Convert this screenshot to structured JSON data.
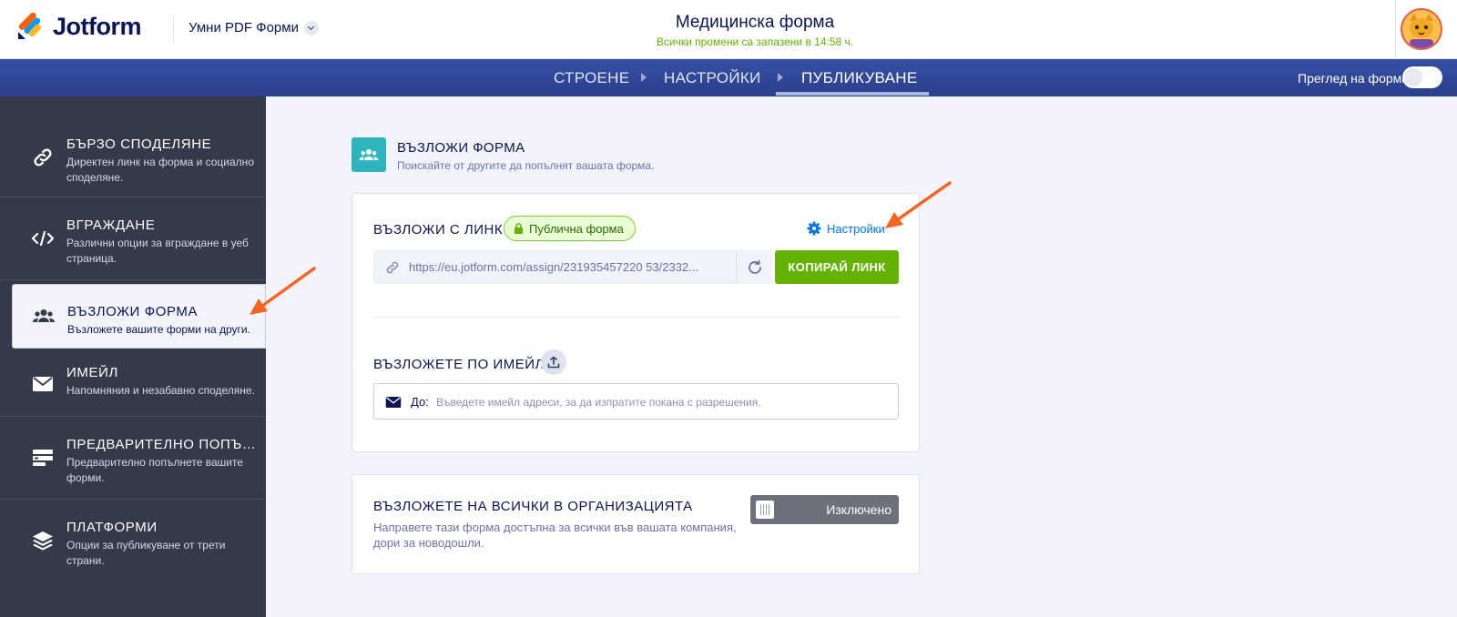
{
  "header": {
    "logo_text": "Jotform",
    "product_name": "Умни PDF Форми",
    "form_title": "Медицинска форма",
    "saved_status": "Всички промени са запазени в 14:58 ч."
  },
  "nav": {
    "tabs": [
      {
        "label": "СТРОЕНЕ"
      },
      {
        "label": "НАСТРОЙКИ"
      },
      {
        "label": "ПУБЛИКУВАНЕ"
      }
    ],
    "active_tab": "ПУБЛИКУВАНЕ",
    "preview_label": "Преглед на форма"
  },
  "sidebar": {
    "items": [
      {
        "title": "БЪРЗО СПОДЕЛЯНЕ",
        "desc": "Директен линк на форма и социално споделяне.",
        "icon": "link-icon"
      },
      {
        "title": "ВГРАЖДАНЕ",
        "desc": "Различни опции за вграждане в уеб страница.",
        "icon": "code-icon"
      },
      {
        "title": "ВЪЗЛОЖИ ФОРМА",
        "desc": "Възложете вашите форми на други.",
        "icon": "users-icon"
      },
      {
        "title": "ИМЕЙЛ",
        "desc": "Напомняния и незабавно споделяне.",
        "icon": "envelope-icon"
      },
      {
        "title": "ПРЕДВАРИТЕЛНО ПОПЪЛ...",
        "desc": "Предварително попълнете вашите форми.",
        "icon": "prefill-icon"
      },
      {
        "title": "ПЛАТФОРМИ",
        "desc": "Опции за публикуване от трети страни.",
        "icon": "layers-icon"
      }
    ],
    "active_index": 2
  },
  "main": {
    "section_title": "ВЪЗЛОЖИ ФОРМА",
    "section_subtitle": "Поискайте от другите да попълнят вашата форма.",
    "assign_link": {
      "label": "ВЪЗЛОЖИ С ЛИНК",
      "badge": "Публична форма",
      "settings_label": "Настройки",
      "url": "https://eu.jotform.com/assign/231935457220 53/2332...",
      "copy_label": "КОПИРАЙ ЛИНК"
    },
    "assign_email": {
      "label": "ВЪЗЛОЖЕТЕ ПО ИМЕЙЛ",
      "to_label": "До:",
      "placeholder": "Въведете имейл адреси, за да изпратите покана с разрешения."
    },
    "assign_org": {
      "label": "ВЪЗЛОЖЕТЕ НА ВСИЧКИ В ОРГАНИЗАЦИЯТА",
      "desc": "Направете тази форма достъпна за всички във вашата компания, дори за новодошли.",
      "toggle_label": "Изключено"
    }
  },
  "colors": {
    "nav_bg": "#2f4696",
    "sidebar_bg": "#343a4a",
    "accent_green": "#64b200",
    "link_blue": "#0075e3",
    "teal": "#2cb5be",
    "arrow_orange": "#f26522"
  }
}
